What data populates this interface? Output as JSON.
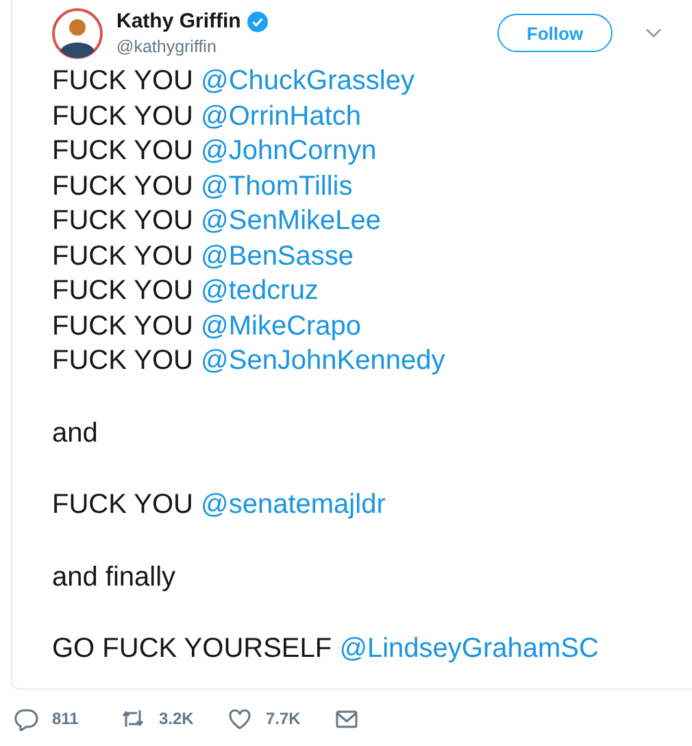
{
  "author": {
    "name": "Kathy Griffin",
    "verified": true,
    "handle": "@kathygriffin"
  },
  "follow_button": {
    "label": "Follow"
  },
  "paragraphs": [
    [
      {
        "text": "FUCK YOU",
        "mention": "@ChuckGrassley"
      },
      {
        "text": "FUCK YOU",
        "mention": "@OrrinHatch"
      },
      {
        "text": "FUCK YOU",
        "mention": "@JohnCornyn"
      },
      {
        "text": "FUCK YOU",
        "mention": "@ThomTillis"
      },
      {
        "text": "FUCK YOU",
        "mention": "@SenMikeLee"
      },
      {
        "text": "FUCK YOU",
        "mention": "@BenSasse"
      },
      {
        "text": "FUCK YOU",
        "mention": "@tedcruz"
      },
      {
        "text": "FUCK YOU",
        "mention": "@MikeCrapo"
      },
      {
        "text": "FUCK YOU",
        "mention": "@SenJohnKennedy"
      }
    ],
    [
      {
        "text": "and"
      }
    ],
    [
      {
        "text": "FUCK YOU",
        "mention": "@senatemajldr"
      }
    ],
    [
      {
        "text": "and finally"
      }
    ],
    [
      {
        "text": "GO FUCK YOURSELF",
        "mention": "@LindseyGrahamSC"
      }
    ]
  ],
  "actions": [
    {
      "kind": "reply",
      "count": "811"
    },
    {
      "kind": "retweet",
      "count": "3.2K"
    },
    {
      "kind": "like",
      "count": "7.7K"
    },
    {
      "kind": "message"
    }
  ]
}
